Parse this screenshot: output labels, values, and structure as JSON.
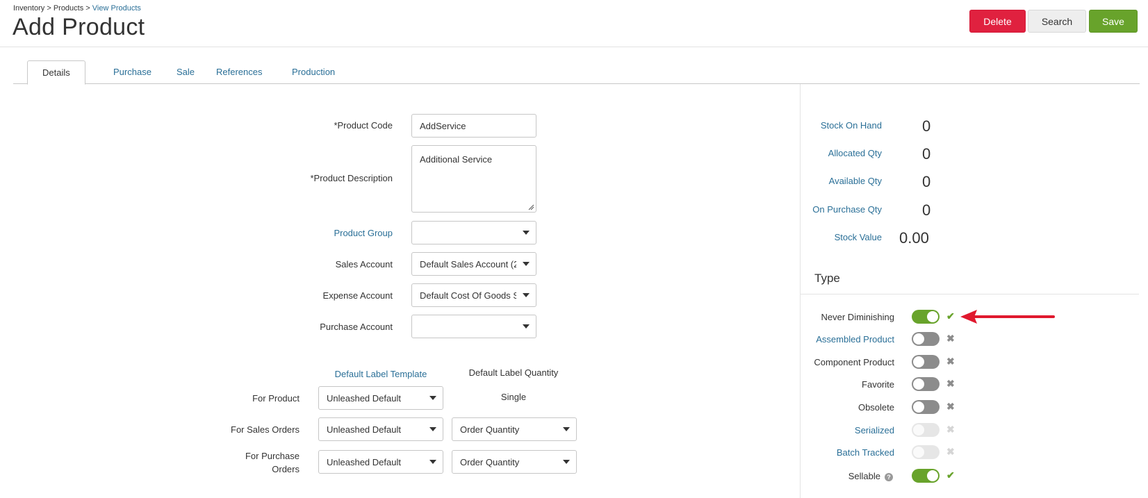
{
  "breadcrumb": {
    "inventory": "Inventory",
    "sep1": ">",
    "products": "Products",
    "sep2": ">",
    "view_products": "View Products"
  },
  "page": {
    "title": "Add Product"
  },
  "toolbar": {
    "delete": "Delete",
    "search": "Search",
    "save": "Save"
  },
  "colors": {
    "delete": "#e0213f",
    "save": "#68a32b",
    "link": "#2a6f97",
    "toggle_on": "#68a32b",
    "toggle_off": "#8c8c8c"
  },
  "tabs": [
    "Details",
    "Purchase",
    "Sale",
    "References",
    "Production"
  ],
  "form": {
    "product_code": {
      "label": "*Product Code",
      "value": "AddService"
    },
    "product_description": {
      "label": "*Product Description",
      "value": "Additional Service"
    },
    "product_group": {
      "label": "Product Group",
      "value": ""
    },
    "sales_account": {
      "label": "Sales Account",
      "value": "Default Sales Account (2"
    },
    "expense_account": {
      "label": "Expense Account",
      "value": "Default Cost Of Goods S"
    },
    "purchase_account": {
      "label": "Purchase Account",
      "value": ""
    }
  },
  "labels": {
    "col_template": "Default Label Template",
    "col_quantity": "Default Label Quantity",
    "rows": [
      {
        "label": "For Product",
        "template": "Unleashed Default",
        "quantity": "Single"
      },
      {
        "label": "For Sales Orders",
        "template": "Unleashed Default",
        "quantity": "Order Quantity"
      },
      {
        "label_line1": "For Purchase",
        "label_line2": "Orders",
        "template": "Unleashed Default",
        "quantity": "Order Quantity"
      }
    ]
  },
  "stock": [
    {
      "label": "Stock On Hand",
      "value": "0"
    },
    {
      "label": "Allocated Qty",
      "value": "0"
    },
    {
      "label": "Available Qty",
      "value": "0"
    },
    {
      "label": "On Purchase Qty",
      "value": "0"
    },
    {
      "label": "Stock Value",
      "value": "0.00"
    }
  ],
  "type": {
    "title": "Type",
    "items": [
      {
        "label": "Never Diminishing",
        "state": "on",
        "mark": "✔"
      },
      {
        "label": "Assembled Product",
        "state": "off",
        "mark": "✖"
      },
      {
        "label": "Component Product",
        "state": "off",
        "mark": "✖"
      },
      {
        "label": "Favorite",
        "state": "off",
        "mark": "✖"
      },
      {
        "label": "Obsolete",
        "state": "off",
        "mark": "✖"
      },
      {
        "label": "Serialized",
        "state": "disabled",
        "mark": "✖"
      },
      {
        "label": "Batch Tracked",
        "state": "disabled",
        "mark": "✖"
      },
      {
        "label": "Sellable",
        "state": "on",
        "mark": "✔",
        "help": "?"
      }
    ]
  },
  "icons": {
    "caret": "chevron-down-icon",
    "check": "check-icon",
    "cross": "cross-icon",
    "help": "help-icon",
    "arrow": "red-arrow-annotation"
  }
}
